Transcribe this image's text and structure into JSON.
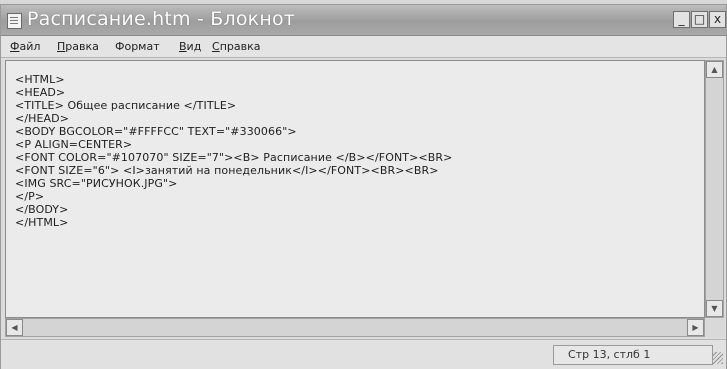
{
  "window": {
    "title": "Расписание.htm - Блокнот",
    "controls": {
      "minimize": "_",
      "maximize": "□",
      "close": "x"
    }
  },
  "menu": {
    "items": [
      {
        "underlined": "Ф",
        "rest": "айл"
      },
      {
        "underlined": "П",
        "rest": "равка"
      },
      {
        "underlined": "",
        "rest": "Формат"
      },
      {
        "underlined": "В",
        "rest": "ид"
      },
      {
        "underlined": "С",
        "rest": "правка"
      }
    ]
  },
  "editor": {
    "lines": [
      "<HTML>",
      "<HEAD>",
      "<TITLE> Общее расписание </TITLE>",
      "</HEAD>",
      "<BODY BGCOLOR=\"#FFFFCC\" TEXT=\"#330066\">",
      "<P ALIGN=CENTER>",
      "<FONT COLOR=\"#107070\" SIZE=\"7\"><B> Расписание </B></FONT><BR>",
      "<FONT SIZE=\"6\"> <I>занятий на понедельник</I></FONT><BR><BR>",
      "<IMG SRC=\"РИСУНОК.JPG\">",
      "</P>",
      "</BODY>",
      "</HTML>"
    ]
  },
  "scroll": {
    "up": "▲",
    "down": "▼",
    "left": "◀",
    "right": "▶"
  },
  "status": {
    "position": "Стр 13, стлб 1"
  }
}
